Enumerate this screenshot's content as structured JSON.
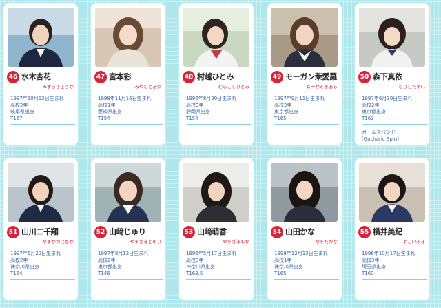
{
  "colors": {
    "accent": "#d6243a",
    "info_text": "#3a67a8",
    "background": "#aee8ec"
  },
  "members": [
    {
      "number": "46",
      "name": "水木杏花",
      "kana": "みずききょうか",
      "birth": "1997年10月12日生まれ",
      "grade": "高校2年",
      "origin": "岐阜県出身",
      "height": "T167",
      "extra": []
    },
    {
      "number": "47",
      "name": "宮本彩",
      "kana": "みやもとあや",
      "birth": "1998年11月16日生まれ",
      "grade": "高校1年",
      "origin": "愛知県出身",
      "height": "T154",
      "extra": []
    },
    {
      "number": "48",
      "name": "村越ひとみ",
      "kana": "むらこしひとみ",
      "birth": "1996年8月20日生まれ",
      "grade": "高校3年",
      "origin": "静岡県出身",
      "height": "T154",
      "extra": []
    },
    {
      "number": "49",
      "name": "モーガン茉愛羅",
      "kana": "もーがんまあら",
      "birth": "1997年9月11日生まれ",
      "grade": "高校2年",
      "origin": "東京都出身",
      "height": "T165",
      "extra": []
    },
    {
      "number": "50",
      "name": "森下真依",
      "kana": "もりしたまい",
      "birth": "1997年6月30日生まれ",
      "grade": "高校2年",
      "origin": "東京都出身",
      "height": "T163",
      "extra": [
        "ガールズバンド",
        "[Gacharic Spin]"
      ]
    },
    {
      "number": "51",
      "name": "山川二千翔",
      "kana": "やまかわにちか",
      "birth": "1997年5月22日生まれ",
      "grade": "高校2年",
      "origin": "神奈川県出身",
      "height": "T164",
      "extra": []
    },
    {
      "number": "52",
      "name": "山﨑じゅり",
      "kana": "やまざきじゅり",
      "birth": "1997年8月12日生まれ",
      "grade": "高校2年",
      "origin": "東京都出身",
      "height": "T146",
      "extra": []
    },
    {
      "number": "53",
      "name": "山﨑萌香",
      "kana": "やまざきもか",
      "birth": "1996年5月17日生まれ",
      "grade": "高校3年",
      "origin": "神奈川県出身",
      "height": "T163.5",
      "extra": []
    },
    {
      "number": "54",
      "name": "山田かな",
      "kana": "やまだかな",
      "birth": "1998年12月13日生まれ",
      "grade": "高校1年",
      "origin": "神奈川県出身",
      "height": "T165",
      "extra": []
    },
    {
      "number": "55",
      "name": "横井美紀",
      "kana": "よこいみき",
      "birth": "1996年10月17日生まれ",
      "grade": "高校3年",
      "origin": "埼玉県出身",
      "height": "T160",
      "extra": []
    }
  ]
}
